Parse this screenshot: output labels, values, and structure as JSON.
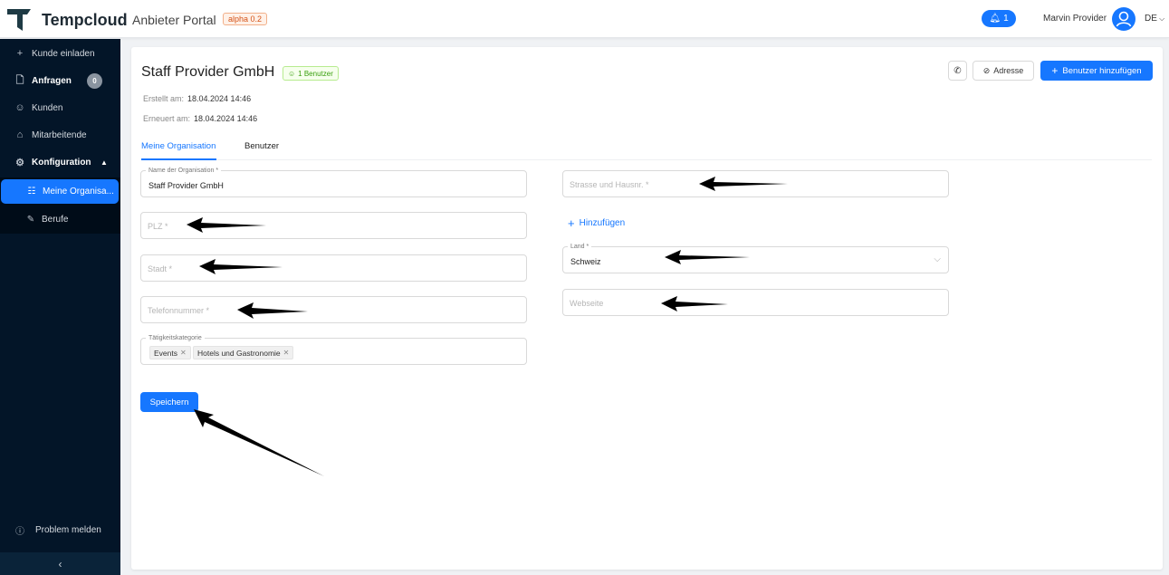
{
  "app": {
    "brand": "Tempcloud",
    "subtitle": "Anbieter Portal",
    "version_badge": "alpha 0.2",
    "notification_count": "1",
    "user_name": "Marvin Provider",
    "language": "DE"
  },
  "sidebar": {
    "items": [
      {
        "label": "Kunde einladen",
        "icon": "plus-icon"
      },
      {
        "label": "Anfragen",
        "icon": "document-icon",
        "badge": "0"
      },
      {
        "label": "Kunden",
        "icon": "users-icon"
      },
      {
        "label": "Mitarbeitende",
        "icon": "team-icon"
      },
      {
        "label": "Konfiguration",
        "icon": "gear-icon"
      }
    ],
    "submenu": [
      {
        "label": "Meine Organisa...",
        "icon": "org-icon",
        "active": true
      },
      {
        "label": "Berufe",
        "icon": "tool-icon"
      }
    ],
    "report": "Problem melden",
    "collapse_icon": "‹"
  },
  "header": {
    "company": "Staff Provider GmbH",
    "users_tag": "1 Benutzer",
    "created_label": "Erstellt am:",
    "created_value": "18.04.2024 14:46",
    "updated_label": "Erneuert am:",
    "updated_value": "18.04.2024 14:46",
    "address_button": "Adresse",
    "add_user_button": "Benutzer hinzufügen"
  },
  "tabs": [
    "Meine Organisation",
    "Benutzer"
  ],
  "form": {
    "org_name_label": "Name der Organisation *",
    "org_name_value": "Staff Provider GmbH",
    "plz_placeholder": "PLZ *",
    "city_placeholder": "Stadt *",
    "phone_placeholder": "Telefonnummer *",
    "category_label": "Tätigkeitskategorie",
    "categories": [
      "Events",
      "Hotels und Gastronomie"
    ],
    "street_placeholder": "Strasse und Hausnr. *",
    "add_link": "Hinzufügen",
    "country_label": "Land *",
    "country_value": "Schweiz",
    "website_placeholder": "Webseite",
    "save_button": "Speichern"
  },
  "colors": {
    "primary": "#1677ff",
    "sidebar_bg": "#031528",
    "success": "#389e0d",
    "alpha": "#d4541a"
  }
}
